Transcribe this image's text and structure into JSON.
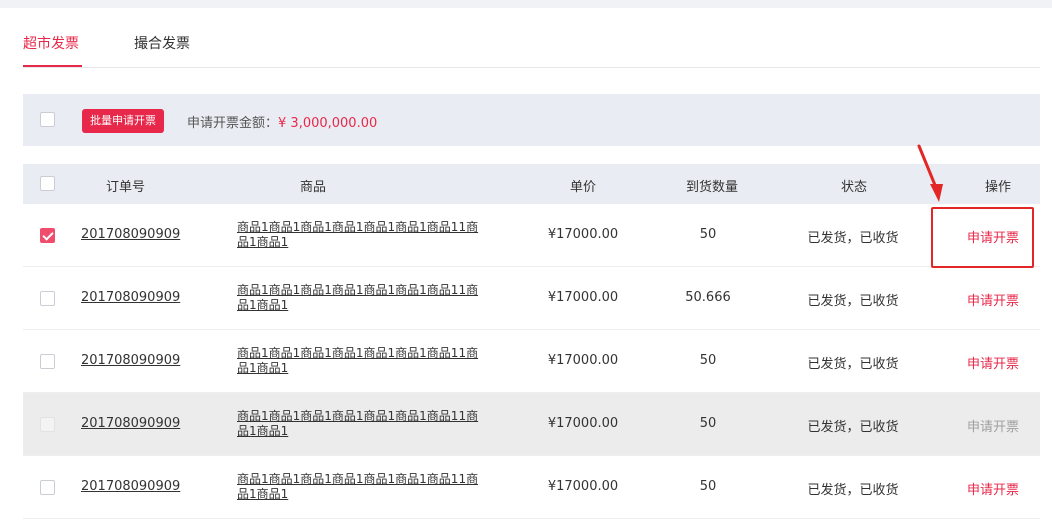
{
  "tabs": [
    {
      "label": "超市发票",
      "active": true
    },
    {
      "label": "撮合发票",
      "active": false
    }
  ],
  "batch": {
    "button_label": "批量申请开票",
    "amount_label": "申请开票金额：",
    "amount_value": "¥ 3,000,000.00"
  },
  "table": {
    "headers": {
      "order_no": "订单号",
      "goods": "商品",
      "price": "单价",
      "qty": "到货数量",
      "status": "状态",
      "action": "操作"
    },
    "rows": [
      {
        "checked": true,
        "disabled": false,
        "order_no": "201708090909",
        "goods": "商品1商品1商品1商品1商品1商品1商品11商品1商品1",
        "price": "¥17000.00",
        "qty": "50",
        "status": "已发货，已收货",
        "action": "申请开票"
      },
      {
        "checked": false,
        "disabled": false,
        "order_no": "201708090909",
        "goods": "商品1商品1商品1商品1商品1商品1商品11商品1商品1",
        "price": "¥17000.00",
        "qty": "50.666",
        "status": "已发货，已收货",
        "action": "申请开票"
      },
      {
        "checked": false,
        "disabled": false,
        "order_no": "201708090909",
        "goods": "商品1商品1商品1商品1商品1商品1商品11商品1商品1",
        "price": "¥17000.00",
        "qty": "50",
        "status": "已发货，已收货",
        "action": "申请开票"
      },
      {
        "checked": false,
        "disabled": true,
        "order_no": "201708090909",
        "goods": "商品1商品1商品1商品1商品1商品1商品11商品1商品1",
        "price": "¥17000.00",
        "qty": "50",
        "status": "已发货，已收货",
        "action": "申请开票"
      },
      {
        "checked": false,
        "disabled": false,
        "order_no": "201708090909",
        "goods": "商品1商品1商品1商品1商品1商品1商品11商品1商品1",
        "price": "¥17000.00",
        "qty": "50",
        "status": "已发货，已收货",
        "action": "申请开票"
      }
    ]
  },
  "colors": {
    "accent": "#e8284a",
    "annotation": "#e32626",
    "header_bg": "#e9edf3"
  }
}
